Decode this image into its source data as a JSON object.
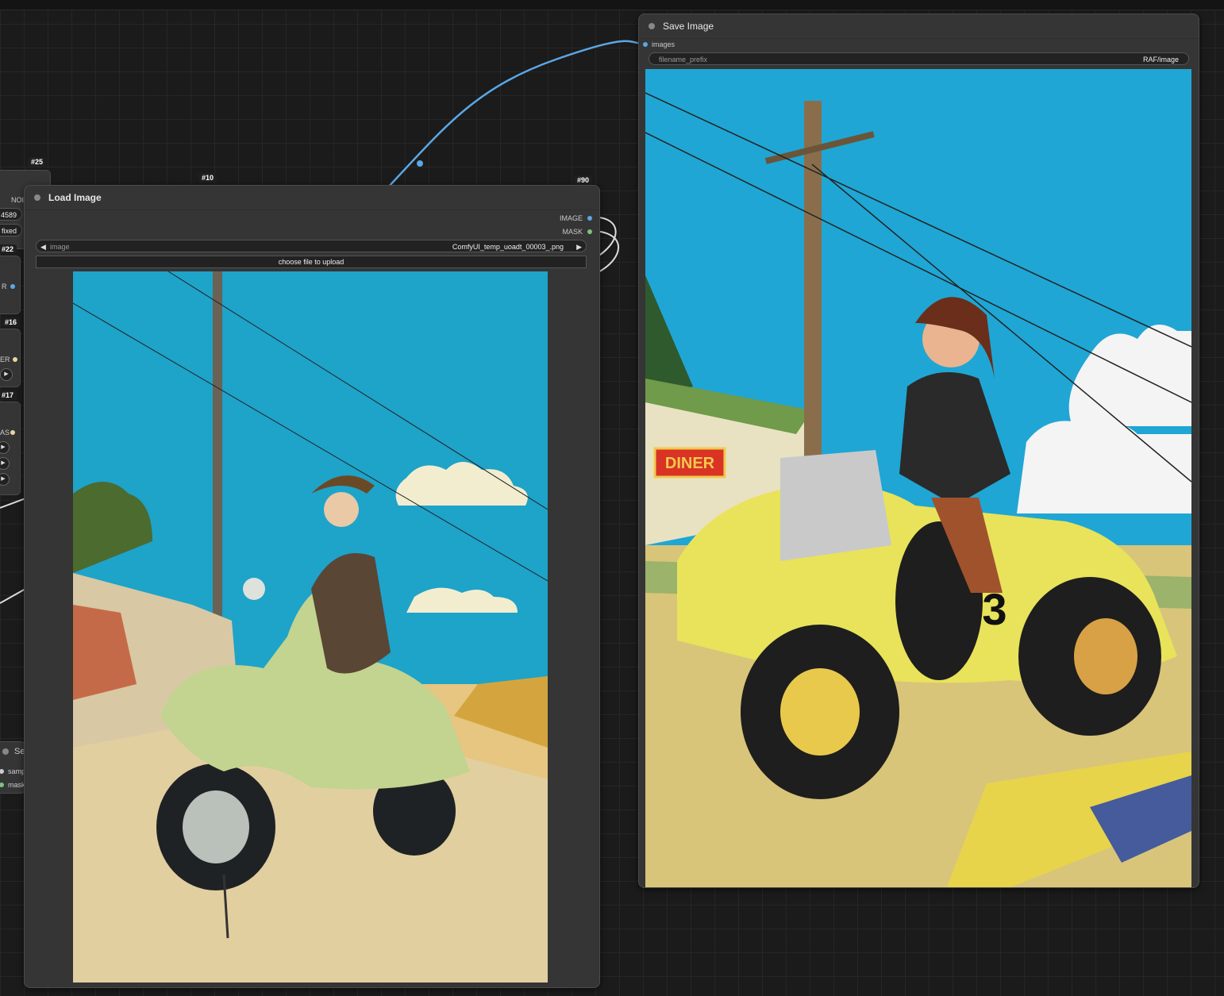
{
  "canvas": {
    "link_color": "#5ba7e6",
    "side_labels": {
      "id25": "#25",
      "id22": "#22",
      "id16": "#16",
      "id17": "#17",
      "noise": "NOI",
      "seed": "4589",
      "control": "fixed",
      "out_r": "R",
      "out_er": "ER",
      "out_as": "AS",
      "se_title": "Se",
      "samp": "samp",
      "mask": "mask"
    }
  },
  "load_image": {
    "title": "Load Image",
    "id_left": "#10",
    "id_right": "#90",
    "outputs": [
      "IMAGE",
      "MASK"
    ],
    "image_widget": {
      "label": "image",
      "value": "ComfyUI_temp_uoadt_00003_.png"
    },
    "upload_label": "choose file to upload",
    "image_colors": {
      "sky": "#1ea3c9",
      "ground": "#e6c680"
    }
  },
  "save_image": {
    "title": "Save Image",
    "input": "images",
    "prefix_widget": {
      "label": "filename_prefix",
      "value": "RAF/image"
    },
    "sign_text": "DINER",
    "car_number": "3"
  }
}
